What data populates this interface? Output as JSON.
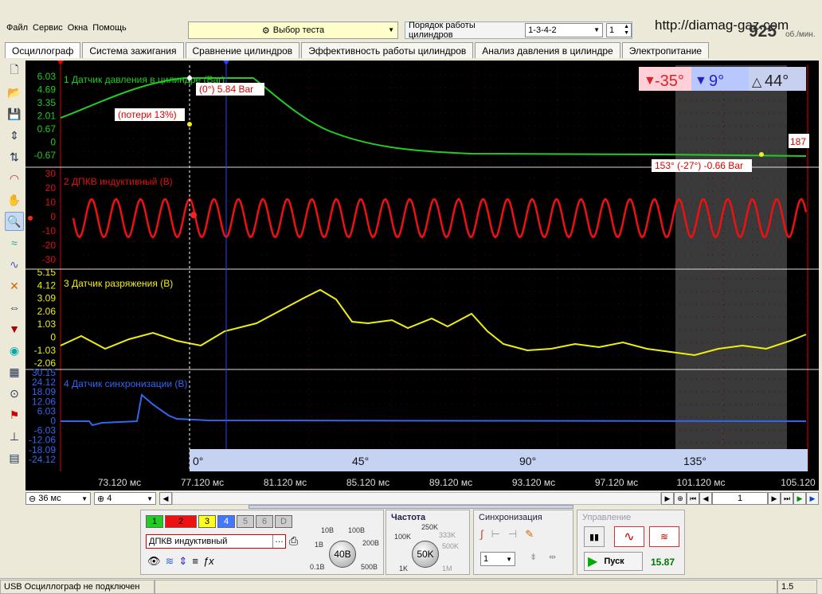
{
  "menu": [
    "Файл",
    "Сервис",
    "Окна",
    "Помощь"
  ],
  "test_select": {
    "label": "Выбор теста"
  },
  "order": {
    "label": "Порядок работы цилиндров",
    "value": "1-3-4-2",
    "spin": "1"
  },
  "url": "http://diamag-gaz.com",
  "rpm": {
    "value": "925",
    "unit": "об./мин."
  },
  "tabs": [
    "Осциллограф",
    "Система зажигания",
    "Сравнение цилиндров",
    "Эффективность работы цилиндров",
    "Анализ давления в цилиндре",
    "Электропитание"
  ],
  "channels": [
    {
      "name": "1 Датчик давления в цилиндре (Bar)",
      "color": "#22cc22",
      "ticks": [
        "6.03",
        "4.69",
        "3.35",
        "2.01",
        "0.67",
        "0",
        "-0.67"
      ]
    },
    {
      "name": "2 ДПКВ индуктивный (В)",
      "color": "#dd1111",
      "ticks": [
        "30",
        "20",
        "10",
        "0",
        "-10",
        "-20",
        "-30"
      ]
    },
    {
      "name": "3 Датчик разряжения (В)",
      "color": "#eeee11",
      "ticks": [
        "5.15",
        "4.12",
        "3.09",
        "2.06",
        "1.03",
        "0",
        "-1.03",
        "-2.06"
      ]
    },
    {
      "name": "4 Датчик синхронизации (В)",
      "color": "#3366ee",
      "ticks": [
        "30.15",
        "24.12",
        "18.09",
        "12.06",
        "6.03",
        "0",
        "-6.03",
        "-12.06",
        "-18.09",
        "-24.12"
      ]
    }
  ],
  "annotations": {
    "cursor1": "(0°) 5.84 Bar",
    "loss": "(потери 13%)",
    "cursor2": "153° (-27°) -0.66 Bar",
    "edge": "187"
  },
  "angles": {
    "a1": "-35°",
    "a2": "9°",
    "a3": "44°"
  },
  "degree_ticks": [
    "0°",
    "45°",
    "90°",
    "135°"
  ],
  "time_ticks": [
    "73.120 мс",
    "77.120 мс",
    "81.120 мс",
    "85.120 мс",
    "89.120 мс",
    "93.120 мс",
    "97.120 мс",
    "101.120 мс",
    "105.120"
  ],
  "bottom": {
    "timebase": "36 мс",
    "channel": "4",
    "page": "1"
  },
  "channel_buttons": [
    "1",
    "2",
    "3",
    "4",
    "5",
    "6",
    "D"
  ],
  "sensor": "ДПКВ индуктивный",
  "voltage": {
    "value": "40В",
    "ticks": [
      "10В",
      "100В",
      "1В",
      "200В",
      "0.1В",
      "500В"
    ]
  },
  "frequency": {
    "title": "Частота",
    "value": "50K",
    "ticks": [
      "250K",
      "333K",
      "100K",
      "500K",
      "1K",
      "1M"
    ]
  },
  "sync": {
    "title": "Синхронизация",
    "value": "1"
  },
  "control": {
    "title": "Управление",
    "start": "Пуск",
    "fps": "15.87"
  },
  "status": {
    "text": "USB Осциллограф не подключен",
    "right": "1.5"
  }
}
